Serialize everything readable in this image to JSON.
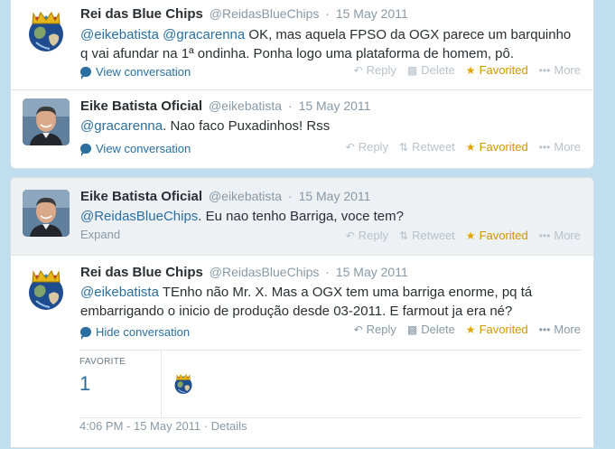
{
  "tweets": [
    {
      "fullname": "Rei das Blue Chips",
      "username": "@ReidasBlueChips",
      "date": "15 May 2011",
      "mention1": "@eikebatista",
      "mention2": "@gracarenna",
      "text": " OK, mas aquela FPSO da OGX parece um barquinho q vai afundar na 1ª ondinha. Ponha logo uma plataforma de homem, pô.",
      "link": "View conversation",
      "reply": "Reply",
      "delete": "Delete",
      "favorited": "Favorited",
      "more": "More"
    },
    {
      "fullname": "Eike Batista Oficial",
      "username": "@eikebatista",
      "date": "15 May 2011",
      "mention1": "@gracarenna",
      "text": ". Nao faco Puxadinhos! Rss",
      "link": "View conversation",
      "reply": "Reply",
      "retweet": "Retweet",
      "favorited": "Favorited",
      "more": "More"
    },
    {
      "fullname": "Eike Batista Oficial",
      "username": "@eikebatista",
      "date": "15 May 2011",
      "mention1": "@ReidasBlueChips",
      "text": ". Eu nao tenho Barriga, voce tem?",
      "link": "Expand",
      "reply": "Reply",
      "retweet": "Retweet",
      "favorited": "Favorited",
      "more": "More"
    },
    {
      "fullname": "Rei das Blue Chips",
      "username": "@ReidasBlueChips",
      "date": "15 May 2011",
      "mention1": "@eikebatista",
      "text": " TEnho não Mr. X.  Mas a OGX tem uma barriga enorme, pq tá embarrigando o inicio de produção desde 03-2011. E farmout ja era né?",
      "link": "Hide conversation",
      "reply": "Reply",
      "delete": "Delete",
      "favorited": "Favorited",
      "more": "More"
    }
  ],
  "stats": {
    "label": "FAVORITE",
    "value": "1"
  },
  "footer": {
    "timestamp": "4:06 PM - 15 May 2011",
    "separator": "·",
    "details": "Details"
  },
  "sep": "·",
  "icons": {
    "reply": "reply-arrow-icon",
    "delete": "trash-icon",
    "retweet": "retweet-icon",
    "favorite": "star-icon",
    "more": "ellipsis-icon",
    "conversation": "speech-bubble-icon"
  },
  "colors": {
    "background": "#c0deed",
    "link": "#2a6f9e",
    "favorite": "#e0a600",
    "muted": "#8899a6"
  }
}
